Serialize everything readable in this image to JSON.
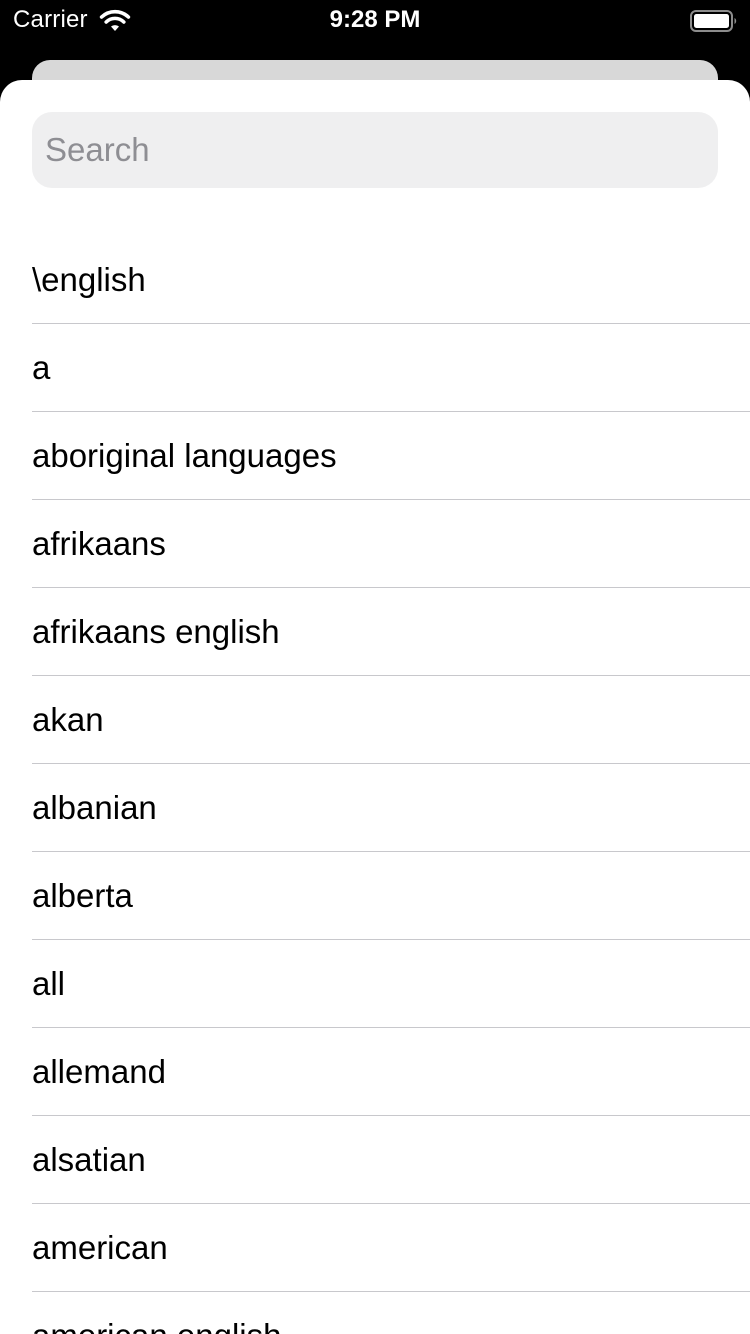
{
  "status_bar": {
    "carrier": "Carrier",
    "time": "9:28 PM"
  },
  "search": {
    "placeholder": "Search",
    "value": ""
  },
  "list": {
    "items": [
      "\\english",
      "a",
      "aboriginal languages",
      "afrikaans",
      "afrikaans english",
      "akan",
      "albanian",
      "alberta",
      "all",
      "allemand",
      "alsatian",
      "american",
      "american english"
    ]
  },
  "colors": {
    "background": "#000000",
    "sheet": "#ffffff",
    "search_fill": "#efeff0",
    "placeholder": "#8e8e93",
    "separator": "#c8c8cc"
  },
  "icons": {
    "wifi": "wifi-icon",
    "battery": "battery-icon"
  }
}
